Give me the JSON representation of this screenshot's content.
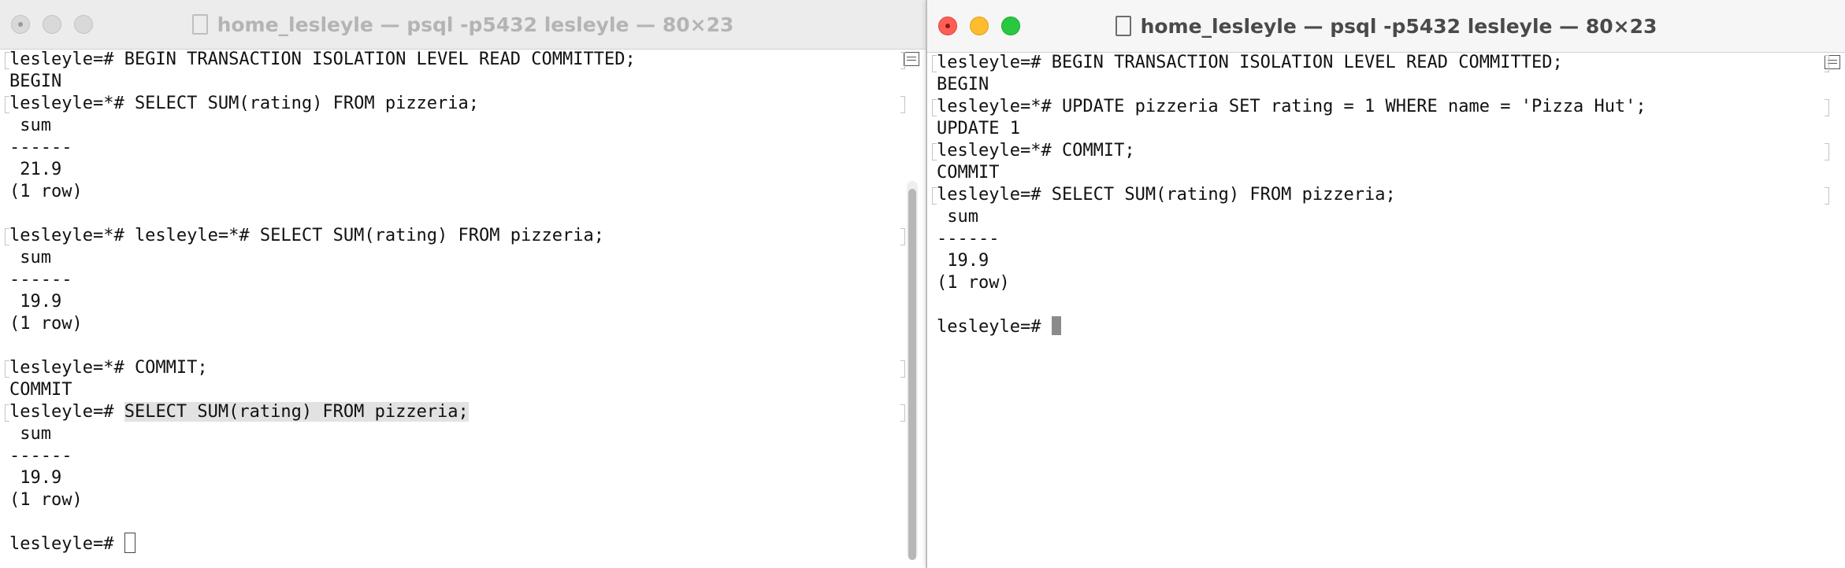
{
  "left_window": {
    "title": "home_lesleyle — psql -p5432 lesleyle — 80×23",
    "lines": [
      {
        "text": "lesleyle=# BEGIN TRANSACTION ISOLATION LEVEL READ COMMITTED;",
        "marked": true
      },
      {
        "text": "BEGIN",
        "marked": false
      },
      {
        "text": "lesleyle=*# SELECT SUM(rating) FROM pizzeria;",
        "marked": true
      },
      {
        "text": " sum",
        "marked": false
      },
      {
        "text": "------",
        "marked": false
      },
      {
        "text": " 21.9",
        "marked": false
      },
      {
        "text": "(1 row)",
        "marked": false
      },
      {
        "text": "",
        "marked": false
      },
      {
        "text": "lesleyle=*# lesleyle=*# SELECT SUM(rating) FROM pizzeria;",
        "marked": true
      },
      {
        "text": " sum",
        "marked": false
      },
      {
        "text": "------",
        "marked": false
      },
      {
        "text": " 19.9",
        "marked": false
      },
      {
        "text": "(1 row)",
        "marked": false
      },
      {
        "text": "",
        "marked": false
      },
      {
        "text": "lesleyle=*# COMMIT;",
        "marked": true
      },
      {
        "text": "COMMIT",
        "marked": false
      }
    ],
    "highlight_line": {
      "prompt": "lesleyle=# ",
      "selected": "SELECT SUM(rating) FROM pizzeria;"
    },
    "after_lines": [
      {
        "text": " sum",
        "marked": false
      },
      {
        "text": "------",
        "marked": false
      },
      {
        "text": " 19.9",
        "marked": false
      },
      {
        "text": "(1 row)",
        "marked": false
      },
      {
        "text": "",
        "marked": false
      }
    ],
    "prompt": "lesleyle=# "
  },
  "right_window": {
    "title": "home_lesleyle — psql -p5432 lesleyle — 80×23",
    "lines": [
      {
        "text": "lesleyle=# BEGIN TRANSACTION ISOLATION LEVEL READ COMMITTED;",
        "marked": true
      },
      {
        "text": "BEGIN",
        "marked": false
      },
      {
        "text": "lesleyle=*# UPDATE pizzeria SET rating = 1 WHERE name = 'Pizza Hut';",
        "marked": true
      },
      {
        "text": "UPDATE 1",
        "marked": false
      },
      {
        "text": "lesleyle=*# COMMIT;",
        "marked": true
      },
      {
        "text": "COMMIT",
        "marked": false
      },
      {
        "text": "lesleyle=# SELECT SUM(rating) FROM pizzeria;",
        "marked": true
      },
      {
        "text": " sum",
        "marked": false
      },
      {
        "text": "------",
        "marked": false
      },
      {
        "text": " 19.9",
        "marked": false
      },
      {
        "text": "(1 row)",
        "marked": false
      },
      {
        "text": "",
        "marked": false
      }
    ],
    "prompt": "lesleyle=# "
  }
}
